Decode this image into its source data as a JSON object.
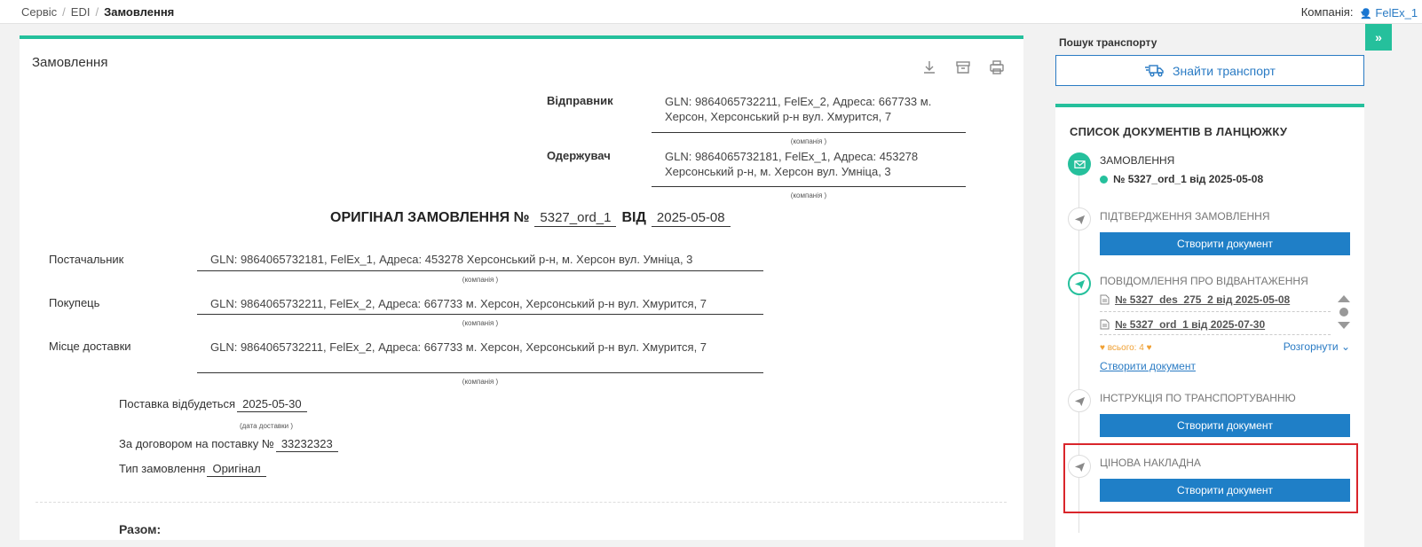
{
  "breadcrumb": {
    "items": [
      "Сервіс",
      "EDI"
    ],
    "current": "Замовлення"
  },
  "company": {
    "label": "Компанія:",
    "value": "FelEx_1 (9864065732181)"
  },
  "doc": {
    "title": "Замовлення",
    "sender_label": "Відправник",
    "sender_value": "GLN: 9864065732211, FelEx_2, Адреса: 667733 м. Херсон, Херсонський р-н вул. Хмурится, 7",
    "company_caption": "(компанія )",
    "receiver_label": "Одержувач",
    "receiver_value": "GLN: 9864065732181, FelEx_1, Адреса: 453278 Херсонський р-н, м. Херсон вул. Умніца, 3",
    "order_heading": "ОРИГІНАЛ ЗАМОВЛЕННЯ №",
    "order_number": "5327_ord_1",
    "from_word": "ВІД",
    "order_date": "2025-05-08",
    "supplier_label": "Постачальник",
    "supplier_value": "GLN: 9864065732181, FelEx_1, Адреса: 453278 Херсонський р-н, м. Херсон вул. Умніца, 3",
    "buyer_label": "Покупець",
    "buyer_value": "GLN: 9864065732211, FelEx_2, Адреса: 667733 м. Херсон, Херсонський р-н вул. Хмурится, 7",
    "delivery_label": "Місце доставки",
    "delivery_value": "GLN: 9864065732211, FelEx_2, Адреса: 667733 м. Херсон, Херсонський р-н вул. Хмурится, 7",
    "delivery_date_label": "Поставка відбудеться",
    "delivery_date": "2025-05-30",
    "delivery_date_caption": "(дата доставки )",
    "contract_label": "За договором на поставку №",
    "contract_value": "33232323",
    "order_type_label": "Тип замовлення",
    "order_type_value": "Оригінал",
    "total_label": "Разом:"
  },
  "side": {
    "search_heading": "Пошук транспорту",
    "find_button": "Знайти транспорт",
    "chain_title": "СПИСОК ДОКУМЕНТІВ В ЛАНЦЮЖКУ",
    "steps": {
      "order": {
        "label": "ЗАМОВЛЕННЯ",
        "doc": "№ 5327_ord_1 від 2025-05-08"
      },
      "confirm": {
        "label": "ПІДТВЕРДЖЕННЯ ЗАМОВЛЕННЯ",
        "button": "Створити документ"
      },
      "despatch": {
        "label": "ПОВІДОМЛЕННЯ ПРО ВІДВАНТАЖЕННЯ",
        "docs": [
          "№ 5327_des_275_2 від 2025-05-08",
          "№ 5327_ord_1 від 2025-07-30"
        ],
        "total": "♥ всього: 4 ♥",
        "expand": "Розгорнути",
        "create_link": "Створити документ"
      },
      "transport": {
        "label": "ІНСТРУКЦІЯ ПО ТРАНСПОРТУВАННЮ",
        "button": "Створити документ"
      },
      "price": {
        "label": "ЦІНОВА НАКЛАДНА",
        "button": "Створити документ"
      }
    }
  },
  "colors": {
    "accent": "#25c09c",
    "primary": "#1f7fc7",
    "highlight": "#d9252b"
  }
}
